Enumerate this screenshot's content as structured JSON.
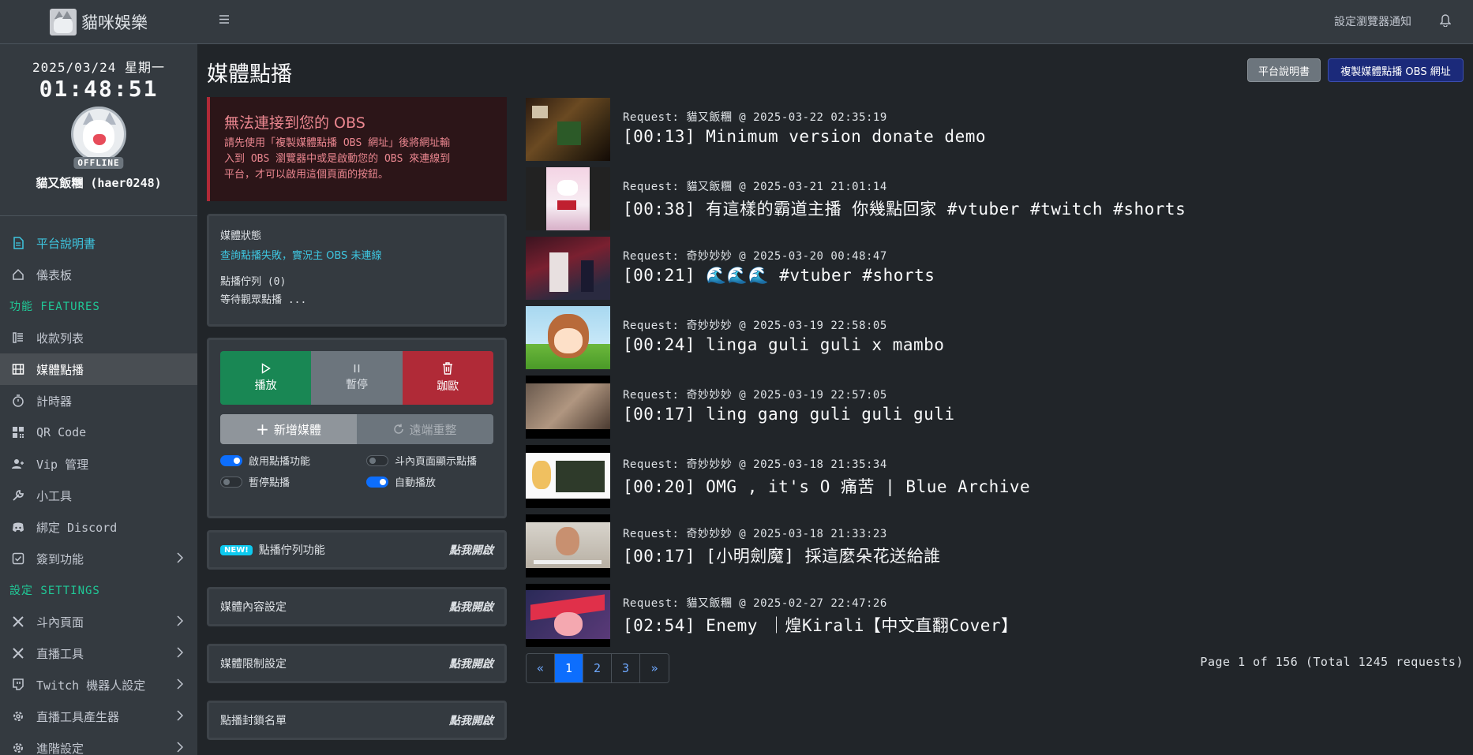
{
  "brand": {
    "name": "貓咪娛樂"
  },
  "clock": {
    "date": "2025/03/24 星期一",
    "time": "01:48:51"
  },
  "user": {
    "status": "OFFLINE",
    "name": "貓又飯糰 (haer0248)"
  },
  "nav": {
    "top": [
      {
        "label": "平台說明書",
        "icon": "document-icon"
      },
      {
        "label": "儀表板",
        "icon": "home-icon"
      }
    ],
    "features_header": "功能 FEATURES",
    "features": [
      {
        "label": "收款列表",
        "icon": "list-icon"
      },
      {
        "label": "媒體點播",
        "icon": "film-icon"
      },
      {
        "label": "計時器",
        "icon": "stopwatch-icon"
      },
      {
        "label": "QR Code",
        "icon": "qr-code-icon"
      },
      {
        "label": "Vip 管理",
        "icon": "user-plus-icon"
      },
      {
        "label": "小工具",
        "icon": "wrench-icon"
      },
      {
        "label": "綁定 Discord",
        "icon": "discord-icon"
      },
      {
        "label": "簽到功能",
        "icon": "check-square-icon"
      }
    ],
    "settings_header": "設定 SETTINGS",
    "settings": [
      {
        "label": "斗內頁面",
        "icon": "tools-icon"
      },
      {
        "label": "直播工具",
        "icon": "tools-icon"
      },
      {
        "label": "Twitch 機器人設定",
        "icon": "chat-icon"
      },
      {
        "label": "直播工具產生器",
        "icon": "gear-icon"
      },
      {
        "label": "進階設定",
        "icon": "gear-icon"
      }
    ]
  },
  "topbar": {
    "notify_label": "設定瀏覽器通知"
  },
  "page": {
    "title": "媒體點播",
    "help_button": "平台說明書",
    "copy_button": "複製媒體點播 OBS 網址"
  },
  "alert": {
    "title": "無法連接到您的 OBS",
    "line1": "請先使用「複製媒體點播 OBS 網址」後將網址輸",
    "line2": "入到 OBS 瀏覽器中或是啟動您的 OBS 來連線到",
    "line3": "平台，才可以啟用這個頁面的按鈕。"
  },
  "status": {
    "label": "媒體狀態",
    "link": "查詢點播失敗，實況主 OBS 未連線",
    "queue": "點播佇列 (0)",
    "waiting": "等待觀眾點播 ..."
  },
  "controls": {
    "play": "播放",
    "pause": "暫停",
    "skip": "跏歐",
    "add": "新增媒體",
    "reset": "遠端重整",
    "toggles": [
      {
        "label": "啟用點播功能",
        "on": true
      },
      {
        "label": "斗內頁面顯示點播",
        "on": false
      },
      {
        "label": "暫停點播",
        "on": false
      },
      {
        "label": "自動播放",
        "on": true
      }
    ]
  },
  "accordions": [
    {
      "label": "點播佇列功能",
      "badge": "NEW!",
      "action": "點我開啟"
    },
    {
      "label": "媒體內容設定",
      "action": "點我開啟"
    },
    {
      "label": "媒體限制設定",
      "action": "點我開啟"
    },
    {
      "label": "點播封鎖名單",
      "action": "點我開啟"
    }
  ],
  "requests": [
    {
      "meta": "Request: 貓又飯糰 @ 2025-03-22 02:35:19",
      "title": "[00:13] Minimum version donate demo"
    },
    {
      "meta": "Request: 貓又飯糰 @ 2025-03-21 21:01:14",
      "title": "[00:38] 有這樣的霸道主播 你幾點回家 #vtuber #twitch #shorts"
    },
    {
      "meta": "Request: 奇妙妙妙 @ 2025-03-20 00:48:47",
      "title": "[00:21] 🌊🌊🌊 #vtuber #shorts"
    },
    {
      "meta": "Request: 奇妙妙妙 @ 2025-03-19 22:58:05",
      "title": "[00:24] linga guli guli x mambo"
    },
    {
      "meta": "Request: 奇妙妙妙 @ 2025-03-19 22:57:05",
      "title": "[00:17] ling gang guli guli guli"
    },
    {
      "meta": "Request: 奇妙妙妙 @ 2025-03-18 21:35:34",
      "title": "[00:20] OMG , it's O 痛苦 | Blue Archive"
    },
    {
      "meta": "Request: 奇妙妙妙 @ 2025-03-18 21:33:23",
      "title": "[00:17] [小明劍魔] 採這麼朵花送給誰"
    },
    {
      "meta": "Request: 貓又飯糰 @ 2025-02-27 22:47:26",
      "title": "[02:54] Enemy ｜煌Kirali【中文直翻Cover】"
    }
  ],
  "pagination": {
    "prev": "«",
    "pages": [
      "1",
      "2",
      "3"
    ],
    "next": "»",
    "info": "Page 1 of 156 (Total 1245 requests)"
  },
  "colors": {
    "sidebar_bg": "#343a40",
    "body_bg": "#212529",
    "accent": "#3ec6e0",
    "section_header": "#20c997",
    "play": "#198754",
    "pause": "#6c757d",
    "skip": "#b02a37",
    "primary": "#0d6efd"
  }
}
